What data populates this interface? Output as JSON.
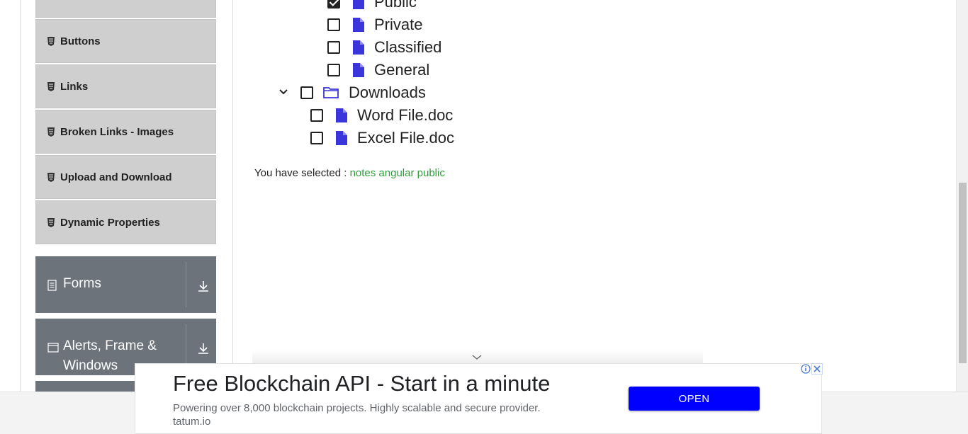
{
  "sidebar": {
    "items": [
      {
        "label": "Buttons"
      },
      {
        "label": "Links"
      },
      {
        "label": "Broken Links - Images"
      },
      {
        "label": "Upload and Download"
      },
      {
        "label": "Dynamic Properties"
      }
    ],
    "groups": [
      {
        "label": "Forms"
      },
      {
        "label_line1": "Alerts, Frame &",
        "label_line2": "Windows"
      }
    ]
  },
  "tree": {
    "nodes": [
      {
        "label": "Public",
        "checked": true
      },
      {
        "label": "Private",
        "checked": false
      },
      {
        "label": "Classified",
        "checked": false
      },
      {
        "label": "General",
        "checked": false
      },
      {
        "label": "Downloads",
        "checked": false,
        "type": "folder",
        "expanded": true
      },
      {
        "label": "Word File.doc",
        "checked": false
      },
      {
        "label": "Excel File.doc",
        "checked": false
      }
    ]
  },
  "selection": {
    "prefix": "You have selected :",
    "values": "notes angular public"
  },
  "ad": {
    "title": "Free Blockchain API - Start in a minute",
    "description": "Powering over 8,000 blockchain projects. Highly scalable and secure provider.",
    "domain": "tatum.io",
    "cta": "OPEN"
  },
  "colors": {
    "sidebar_item_bg": "#cfcfcf",
    "group_bg": "#6c737b",
    "file_icon": "#3b36d9",
    "selected_values": "#2e9e3c",
    "ad_button": "#0000ff"
  }
}
